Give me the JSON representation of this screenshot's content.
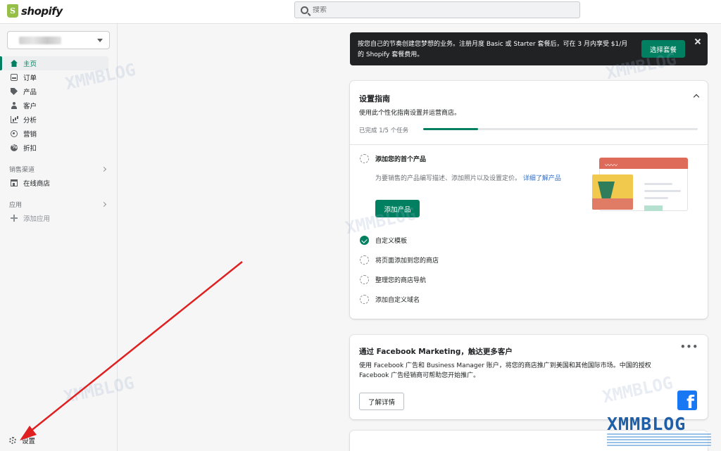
{
  "brand": {
    "name": "shopify"
  },
  "search": {
    "placeholder": "搜索"
  },
  "sidebar": {
    "items": [
      {
        "label": "主页",
        "icon": "home-icon"
      },
      {
        "label": "订单",
        "icon": "orders-icon"
      },
      {
        "label": "产品",
        "icon": "tag-icon"
      },
      {
        "label": "客户",
        "icon": "person-icon"
      },
      {
        "label": "分析",
        "icon": "bar-chart-icon"
      },
      {
        "label": "营销",
        "icon": "target-icon"
      },
      {
        "label": "折扣",
        "icon": "discount-icon"
      }
    ],
    "sales_channels": {
      "label": "销售渠道",
      "items": [
        {
          "label": "在线商店",
          "icon": "store-icon"
        }
      ]
    },
    "apps": {
      "label": "应用",
      "add_label": "添加应用"
    },
    "settings_label": "设置"
  },
  "banner": {
    "text": "按您自己的节奏创建您梦想的业务。注册月度 Basic 或 Starter 套餐后，可在 3 月内享受 $1/月的 Shopify 套餐费用。",
    "button": "选择套餐"
  },
  "setup_guide": {
    "title": "设置指南",
    "subtitle": "使用此个性化指南设置并运营商店。",
    "progress_text": "已完成 1/5 个任务",
    "progress_fraction": 0.2,
    "tasks": [
      {
        "label": "添加您的首个产品",
        "description": "为要销售的产品编写描述、添加照片以及设置定价。",
        "link": "详细了解产品",
        "button": "添加产品",
        "done": false
      },
      {
        "label": "自定义模板",
        "done": true
      },
      {
        "label": "将页面添加到您的商店",
        "done": false
      },
      {
        "label": "整理您的商店导航",
        "done": false
      },
      {
        "label": "添加自定义域名",
        "done": false
      }
    ]
  },
  "facebook_card": {
    "title": "通过 Facebook Marketing，触达更多客户",
    "text": "使用 Facebook 广告和 Business Manager 账户，将您的商店推广到美国和其他国际市场。中国的授权 Facebook 广告经销商可帮助您开始推广。",
    "button": "了解详情",
    "more": "•••"
  },
  "watermark": {
    "text": "XMMBLOG"
  },
  "colors": {
    "accent": "#008060",
    "banner_bg": "#202223",
    "arrow": "#e02020"
  }
}
